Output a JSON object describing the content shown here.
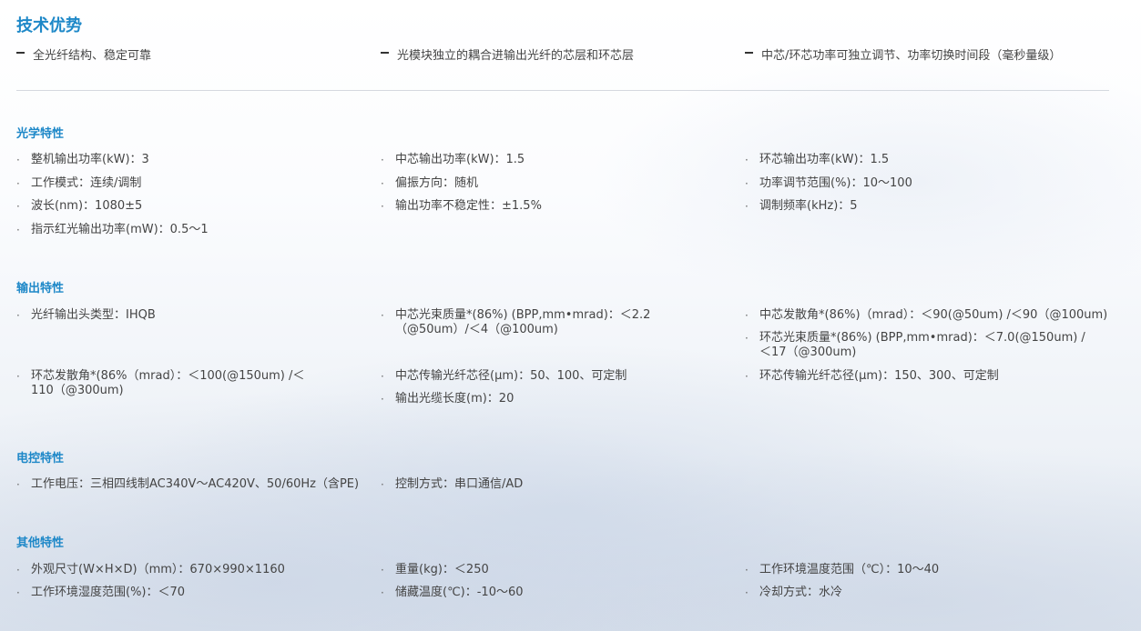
{
  "advantages": {
    "title": "技术优势",
    "items": [
      "全光纤结构、稳定可靠",
      "光模块独立的耦合进输出光纤的芯层和环芯层",
      "中芯/环芯功率可独立调节、功率切换时间段（毫秒量级）"
    ]
  },
  "optical": {
    "title": "光学特性",
    "items": [
      "整机输出功率(kW)：3",
      "中芯输出功率(kW)：1.5",
      "环芯输出功率(kW)：1.5",
      "工作模式：连续/调制",
      "偏振方向：随机",
      "功率调节范围(%)：10～100",
      "波长(nm)：1080±5",
      "输出功率不稳定性：±1.5%",
      "调制频率(kHz)：5",
      "指示红光输出功率(mW)：0.5～1"
    ]
  },
  "output": {
    "title": "输出特性",
    "items": [
      "光纤输出头类型：IHQB",
      "中芯光束质量*(86%) (BPP,mm•mrad)：＜2.2（@50um）/＜4（@100um)",
      "中芯发散角*(86%)（mrad）：＜90(@50um) /＜90（@100um)",
      "环芯光束质量*(86%) (BPP,mm•mrad)：＜7.0(@150um) /＜17（@300um)",
      "环芯发散角*(86%（mrad）：＜100(@150um) /＜110（@300um)",
      "中芯传输光纤芯径(μm)：50、100、可定制",
      "环芯传输光纤芯径(μm)：150、300、可定制",
      "输出光缆长度(m)：20"
    ]
  },
  "electrical": {
    "title": "电控特性",
    "items": [
      "工作电压：三相四线制AC340V～AC420V、50/60Hz（含PE)",
      "控制方式：串口通信/AD"
    ]
  },
  "other": {
    "title": "其他特性",
    "items": [
      "外观尺寸(W×H×D)（mm）：670×990×1160",
      "重量(kg)：＜250",
      "工作环境温度范围（℃）：10～40",
      "工作环境湿度范围(%)：＜70",
      "储藏温度(℃)：-10～60",
      "冷却方式：水冷"
    ]
  }
}
